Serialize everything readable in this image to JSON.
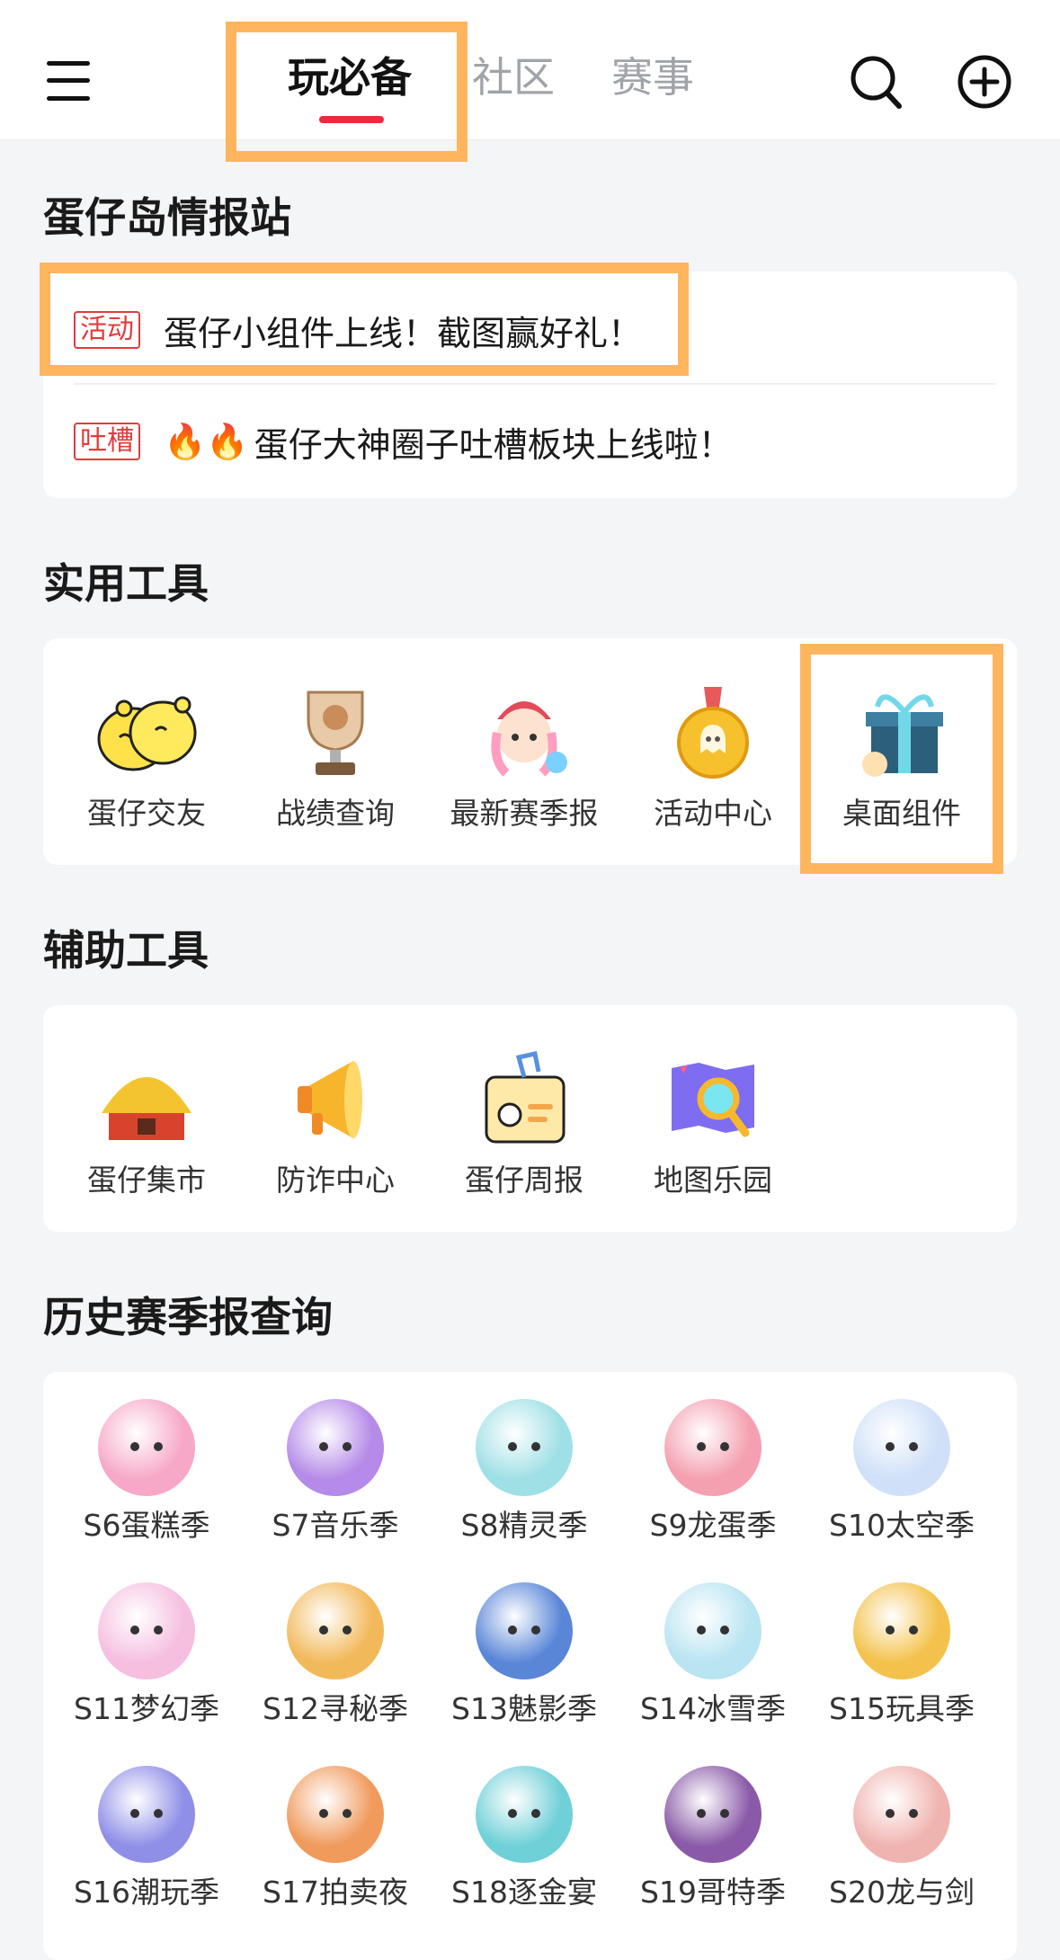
{
  "header": {
    "tabs": [
      {
        "label": "玩必备",
        "active": true
      },
      {
        "label": "社区",
        "active": false
      },
      {
        "label": "赛事",
        "active": false
      }
    ],
    "icons": [
      "menu-icon",
      "search-icon",
      "add-icon"
    ],
    "accent_color": "#f0283c",
    "highlight_color": "#ffb55d"
  },
  "intel": {
    "title": "蛋仔岛情报站",
    "items": [
      {
        "tag": "活动",
        "text": "蛋仔小组件上线！截图赢好礼！"
      },
      {
        "tag": "吐槽",
        "prefix": "🔥🔥",
        "text": "蛋仔大神圈子吐槽板块上线啦！"
      }
    ]
  },
  "tools": {
    "title": "实用工具",
    "items": [
      {
        "label": "蛋仔交友",
        "icon": "two-eggs-hug-icon"
      },
      {
        "label": "战绩查询",
        "icon": "trophy-icon"
      },
      {
        "label": "最新赛季报",
        "icon": "girl-character-icon"
      },
      {
        "label": "活动中心",
        "icon": "medal-icon"
      },
      {
        "label": "桌面组件",
        "icon": "gift-box-icon"
      }
    ]
  },
  "aux": {
    "title": "辅助工具",
    "items": [
      {
        "label": "蛋仔集市",
        "icon": "straw-hut-icon"
      },
      {
        "label": "防诈中心",
        "icon": "megaphone-icon"
      },
      {
        "label": "蛋仔周报",
        "icon": "badge-card-icon"
      },
      {
        "label": "地图乐园",
        "icon": "map-magnifier-icon"
      }
    ]
  },
  "history": {
    "title": "历史赛季报查询",
    "seasons": [
      {
        "label": "S6蛋糕季",
        "color": "#f7a8c8"
      },
      {
        "label": "S7音乐季",
        "color": "#b58ae8"
      },
      {
        "label": "S8精灵季",
        "color": "#9fe0e6"
      },
      {
        "label": "S9龙蛋季",
        "color": "#f4a0b0"
      },
      {
        "label": "S10太空季",
        "color": "#cfe0f8"
      },
      {
        "label": "S11梦幻季",
        "color": "#f6bfe0"
      },
      {
        "label": "S12寻秘季",
        "color": "#f2b95a"
      },
      {
        "label": "S13魅影季",
        "color": "#5a86d8"
      },
      {
        "label": "S14冰雪季",
        "color": "#b9e4f2"
      },
      {
        "label": "S15玩具季",
        "color": "#f4c24c"
      },
      {
        "label": "S16潮玩季",
        "color": "#8f8fe8"
      },
      {
        "label": "S17拍卖夜",
        "color": "#f09a5c"
      },
      {
        "label": "S18逐金宴",
        "color": "#6fd0d8"
      },
      {
        "label": "S19哥特季",
        "color": "#8a5aa8"
      },
      {
        "label": "S20龙与剑",
        "color": "#f0b4b0"
      }
    ]
  }
}
